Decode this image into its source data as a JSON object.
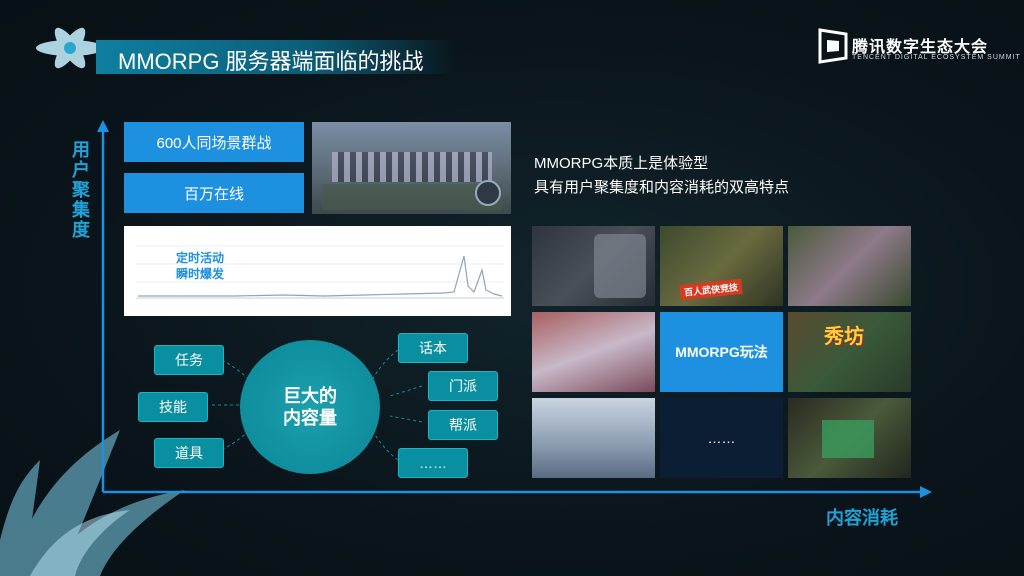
{
  "header": {
    "title": "MMORPG 服务器端面临的挑战",
    "logo_main": "腾讯数字生态大会",
    "logo_sub": "TENCENT DIGITAL ECOSYSTEM SUMMIT"
  },
  "axes": {
    "y_label": "用户聚集度",
    "x_label": "内容消耗"
  },
  "challenges": {
    "box1": "600人同场景群战",
    "box2": "百万在线"
  },
  "chart": {
    "annotation": "定时活动\n瞬时爆发"
  },
  "content": {
    "center": "巨大的\n内容量",
    "left_items": [
      "任务",
      "技能",
      "道具"
    ],
    "right_items": [
      "话本",
      "门派",
      "帮派",
      "……"
    ]
  },
  "description": {
    "line1": "MMORPG本质上是体验型",
    "line2": "具有用户聚集度和内容消耗的双高特点"
  },
  "grid": {
    "center_label": "MMORPG玩法",
    "ellipsis": "……",
    "tile_captions": {
      "vs_banner": "百人武侠竞技",
      "xiufang": "秀坊"
    }
  },
  "colors": {
    "accent_blue": "#1e90e0",
    "teal": "#0a8fa0",
    "axis_label": "#1fa2d6"
  }
}
